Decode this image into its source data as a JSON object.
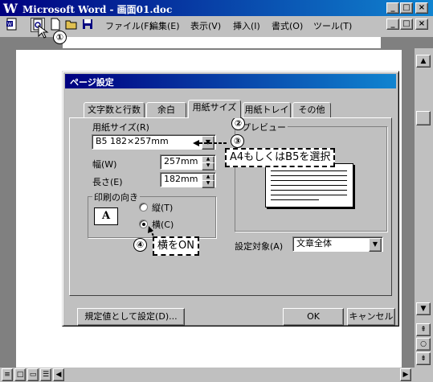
{
  "window": {
    "title": "Microsoft Word - 画面01.doc",
    "caption_buttons": [
      "_",
      "□",
      "×"
    ]
  },
  "menu": {
    "items": [
      "ファイル(F)",
      "編集(E)",
      "表示(V)",
      "挿入(I)",
      "書式(O)",
      "ツール(T)"
    ]
  },
  "icons": {
    "word": "word-logo-icon",
    "preview": "print-preview-icon",
    "new": "new-document-icon",
    "open": "open-folder-icon",
    "save": "save-disk-icon"
  },
  "dialog": {
    "title": "ページ設定",
    "tabs": [
      "文字数と行数",
      "余白",
      "用紙サイズ",
      "用紙トレイ",
      "その他"
    ],
    "active_tab": "用紙サイズ",
    "paper_size_label": "用紙サイズ(R)",
    "paper_size_value": "B5 182×257mm",
    "width_label": "幅(W)",
    "width_value": "257mm",
    "height_label": "長さ(E)",
    "height_value": "182mm",
    "orientation_label": "印刷の向き",
    "portrait_label": "縦(T)",
    "landscape_label": "横(C)",
    "orientation_selected": "横(C)",
    "preview_label": "プレビュー",
    "apply_to_label": "設定対象(A)",
    "apply_to_value": "文章全体",
    "default_button": "規定値として設定(D)...",
    "ok_button": "OK",
    "cancel_button": "キャンセル"
  },
  "annotations": {
    "n1": "①",
    "n2": "②",
    "n3": "③",
    "n4": "④",
    "callout3": "A4もしくはB5を選択",
    "callout4": "横をON"
  }
}
